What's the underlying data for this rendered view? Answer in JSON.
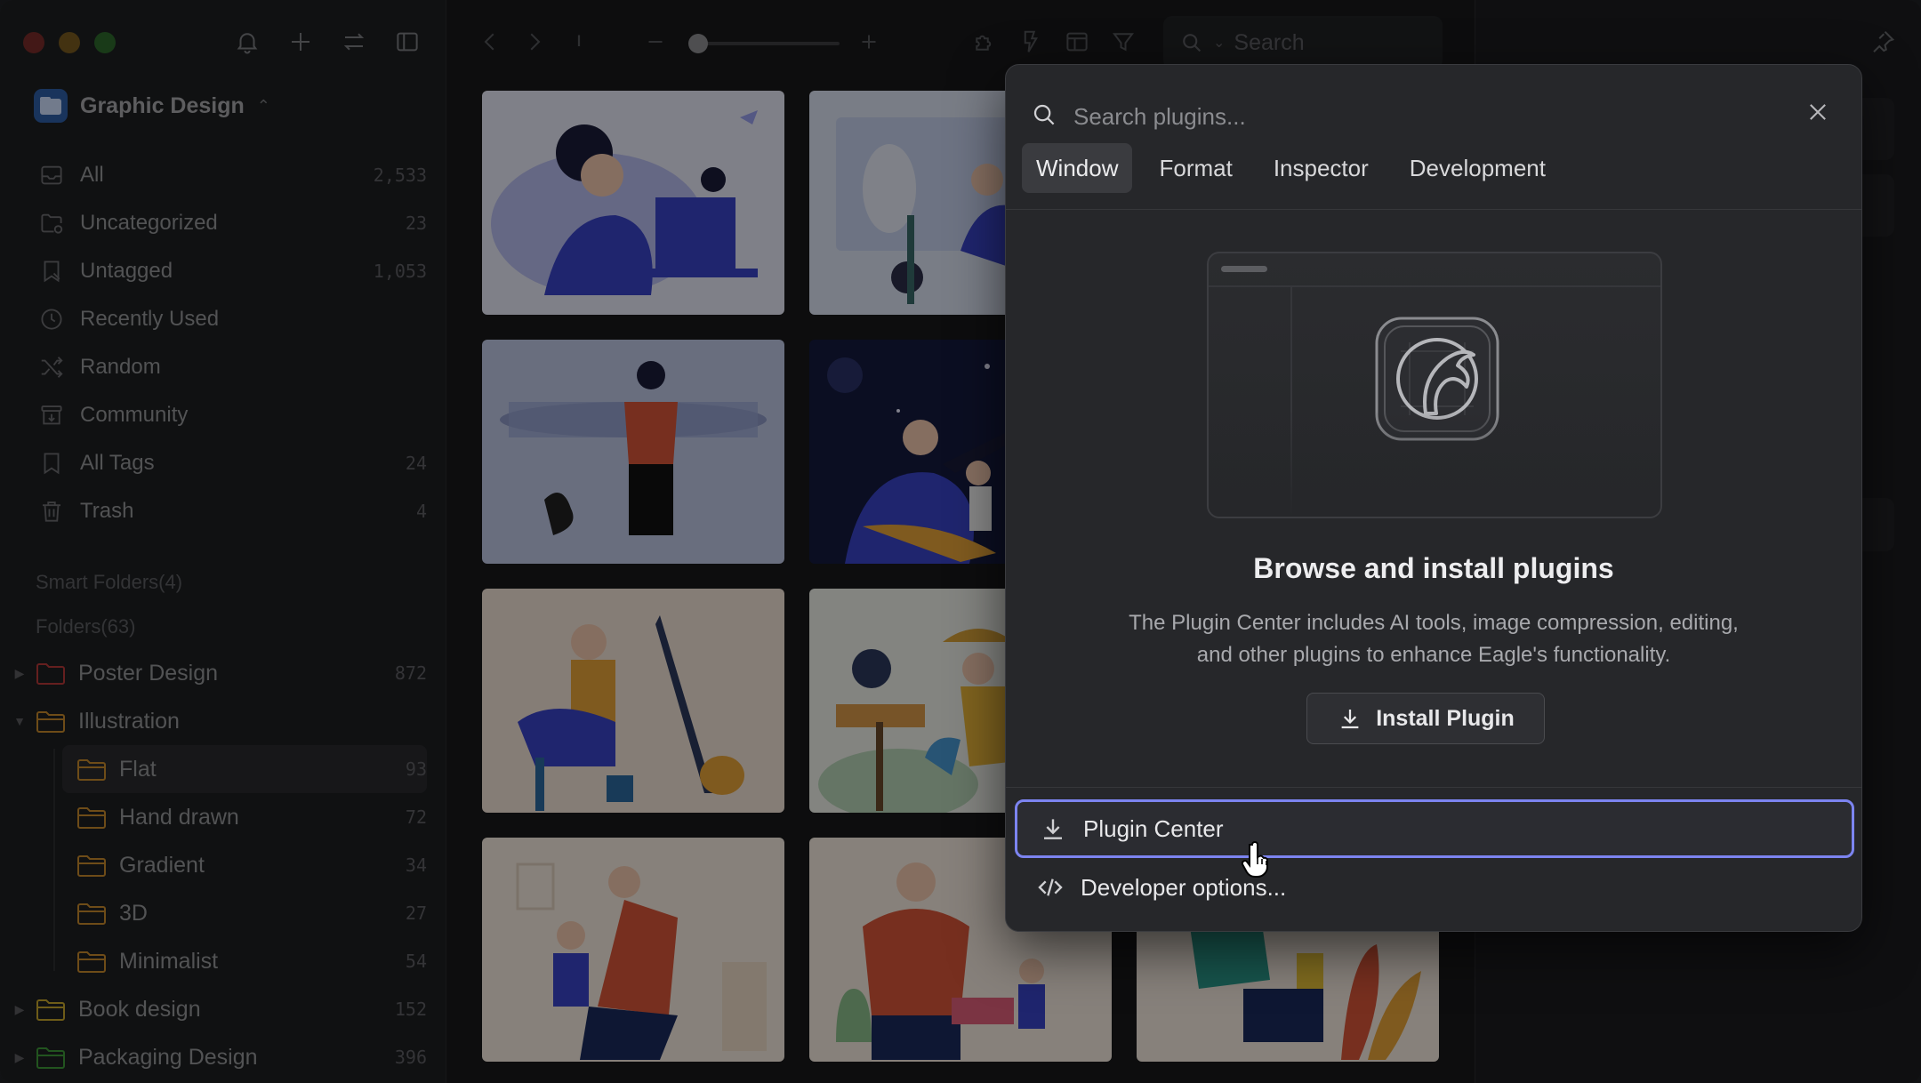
{
  "sidebar": {
    "library_name": "Graphic Design",
    "nav": [
      {
        "label": "All",
        "count": "2,533"
      },
      {
        "label": "Uncategorized",
        "count": "23"
      },
      {
        "label": "Untagged",
        "count": "1,053"
      },
      {
        "label": "Recently Used",
        "count": ""
      },
      {
        "label": "Random",
        "count": ""
      },
      {
        "label": "Community",
        "count": ""
      },
      {
        "label": "All Tags",
        "count": "24"
      },
      {
        "label": "Trash",
        "count": "4"
      }
    ],
    "smart_folders": "Smart Folders(4)",
    "folders_heading": "Folders(63)",
    "folders": [
      {
        "label": "Poster Design",
        "count": "872",
        "color": "#b83a3a"
      },
      {
        "label": "Illustration",
        "count": "",
        "color": "#c98a2c"
      },
      {
        "label": "Flat",
        "count": "93",
        "color": "#c98a2c"
      },
      {
        "label": "Hand drawn",
        "count": "72",
        "color": "#c98a2c"
      },
      {
        "label": "Gradient",
        "count": "34",
        "color": "#c98a2c"
      },
      {
        "label": "3D",
        "count": "27",
        "color": "#c98a2c"
      },
      {
        "label": "Minimalist",
        "count": "54",
        "color": "#c98a2c"
      },
      {
        "label": "Book design",
        "count": "152",
        "color": "#c9a82c"
      },
      {
        "label": "Packaging Design",
        "count": "396",
        "color": "#3f9a3a"
      }
    ]
  },
  "toolbar": {
    "search_placeholder": "Search"
  },
  "plugin_panel": {
    "search_placeholder": "Search plugins...",
    "tabs": [
      "Window",
      "Format",
      "Inspector",
      "Development"
    ],
    "active_tab": "Window",
    "title": "Browse and install plugins",
    "description": "The Plugin Center includes AI tools, image compression, editing, and other plugins to enhance Eagle's functionality.",
    "install_label": "Install Plugin",
    "menu": [
      {
        "label": "Plugin Center",
        "icon": "download-icon"
      },
      {
        "label": "Developer options...",
        "icon": "code-icon"
      }
    ]
  },
  "colors": {
    "accent_focus": "#7c84f0",
    "library_icon": "#2f5fa8"
  }
}
